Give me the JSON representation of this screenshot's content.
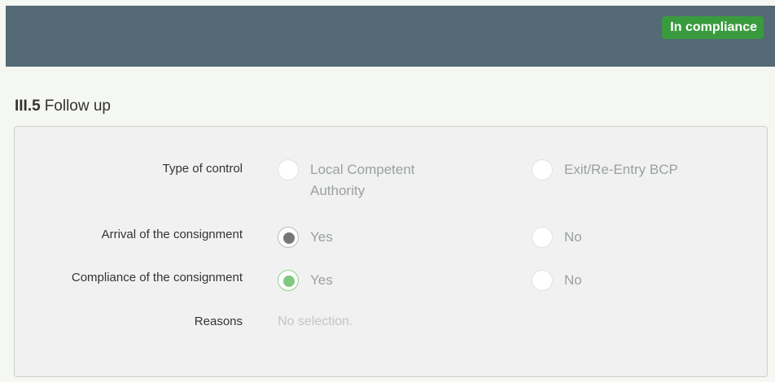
{
  "header": {
    "status_badge": "In compliance",
    "badge_color": "#3a9b3e",
    "bar_color": "#546a75"
  },
  "section": {
    "number": "III.5",
    "title": "Follow up"
  },
  "form": {
    "type_of_control": {
      "label": "Type of control",
      "options": [
        "Local Competent Authority",
        "Exit/Re-Entry BCP"
      ],
      "selected": null
    },
    "arrival": {
      "label": "Arrival of the consignment",
      "options": [
        "Yes",
        "No"
      ],
      "selected": "Yes"
    },
    "compliance": {
      "label": "Compliance of the consignment",
      "options": [
        "Yes",
        "No"
      ],
      "selected": "Yes",
      "selected_color": "#7fc87f"
    },
    "reasons": {
      "label": "Reasons",
      "value": "No selection."
    }
  }
}
